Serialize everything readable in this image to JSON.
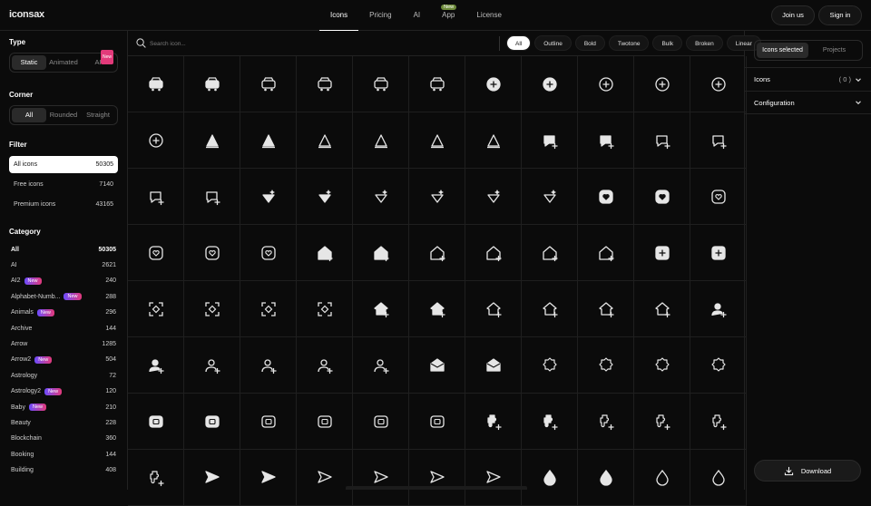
{
  "brand": {
    "logo": "iconsax"
  },
  "nav": {
    "items": [
      {
        "label": "Icons",
        "active": true
      },
      {
        "label": "Pricing"
      },
      {
        "label": "AI"
      },
      {
        "label": "App",
        "badge": "New"
      },
      {
        "label": "License"
      }
    ],
    "join_label": "Join us",
    "signin_label": "Sign in"
  },
  "sidebar": {
    "type_title": "Type",
    "type_options": [
      "Static",
      "Animated",
      "AI"
    ],
    "type_ai_badge": "New",
    "corner_title": "Corner",
    "corner_options": [
      "All",
      "Rounded",
      "Straight"
    ],
    "filter_title": "Filter",
    "filters": [
      {
        "label": "All icons",
        "count": "50305",
        "active": true
      },
      {
        "label": "Free icons",
        "count": "7140"
      },
      {
        "label": "Premium icons",
        "count": "43165"
      }
    ],
    "category_title": "Category",
    "categories": [
      {
        "label": "All",
        "count": "50305",
        "bold": true
      },
      {
        "label": "AI",
        "count": "2621"
      },
      {
        "label": "AI2",
        "count": "240",
        "badge": "New"
      },
      {
        "label": "Alphabet-Numb...",
        "count": "288",
        "badge": "New"
      },
      {
        "label": "Animals",
        "count": "296",
        "badge": "New"
      },
      {
        "label": "Archive",
        "count": "144"
      },
      {
        "label": "Arrow",
        "count": "1285"
      },
      {
        "label": "Arrow2",
        "count": "504",
        "badge": "New"
      },
      {
        "label": "Astrology",
        "count": "72"
      },
      {
        "label": "Astrology2",
        "count": "120",
        "badge": "New"
      },
      {
        "label": "Baby",
        "count": "210",
        "badge": "New"
      },
      {
        "label": "Beauty",
        "count": "228"
      },
      {
        "label": "Blockchain",
        "count": "360"
      },
      {
        "label": "Booking",
        "count": "144"
      },
      {
        "label": "Building",
        "count": "408"
      }
    ]
  },
  "toolbar": {
    "search_placeholder": "Search icon...",
    "styles": [
      "All",
      "Outline",
      "Bold",
      "Twotone",
      "Bulk",
      "Broken",
      "Linear"
    ],
    "active_style": "All"
  },
  "grid": {
    "rows": [
      [
        "car-icon",
        "car-icon",
        "car-icon",
        "car-icon",
        "car-icon",
        "car-icon",
        "add-circle-icon",
        "add-circle-icon",
        "add-circle-icon",
        "add-circle-icon",
        "add-circle-icon"
      ],
      [
        "add-circle-icon",
        "pen-tool-icon",
        "pen-tool-icon",
        "pen-tool-icon",
        "pen-tool-icon",
        "pen-tool-icon",
        "pen-tool-icon",
        "message-add-icon",
        "message-add-icon",
        "message-add-icon",
        "message-add-icon"
      ],
      [
        "message-add-icon",
        "message-add-icon",
        "magic-wand-icon",
        "magic-wand-icon",
        "magic-wand-icon",
        "magic-wand-icon",
        "magic-wand-icon",
        "magic-wand-icon",
        "heart-square-icon",
        "heart-square-icon",
        "heart-square-icon"
      ],
      [
        "heart-square-icon",
        "heart-square-icon",
        "heart-square-icon",
        "home-add-icon",
        "home-add-icon",
        "home-add-icon",
        "home-add-icon",
        "home-add-icon",
        "home-add-icon",
        "square-add-icon",
        "square-add-icon"
      ],
      [
        "scan-add-icon",
        "scan-add-icon",
        "scan-add-icon",
        "scan-add-icon",
        "house-add-icon",
        "house-add-icon",
        "house-add-icon",
        "house-add-icon",
        "house-add-icon",
        "house-add-icon",
        "user-add-icon"
      ],
      [
        "user-add-icon",
        "user-add-icon",
        "user-add-icon",
        "user-add-icon",
        "user-add-icon",
        "mail-add-icon",
        "mail-add-icon",
        "badge-add-icon",
        "badge-add-icon",
        "badge-add-icon",
        "badge-add-icon"
      ],
      [
        "video-add-icon",
        "video-add-icon",
        "video-add-icon",
        "video-add-icon",
        "video-add-icon",
        "video-add-icon",
        "puzzle-add-icon",
        "puzzle-add-icon",
        "puzzle-add-icon",
        "puzzle-add-icon",
        "puzzle-add-icon"
      ],
      [
        "puzzle-add-icon",
        "send-add-icon",
        "send-add-icon",
        "send-add-icon",
        "send-add-icon",
        "send-add-icon",
        "send-add-icon",
        "drop-add-icon",
        "drop-add-icon",
        "drop-add-icon",
        "drop-add-icon"
      ]
    ],
    "filled_rows": [
      [
        1,
        1,
        0,
        0,
        0,
        0,
        1,
        1,
        0,
        0,
        0
      ],
      [
        0,
        1,
        1,
        0,
        0,
        0,
        0,
        1,
        1,
        0,
        0
      ],
      [
        0,
        0,
        1,
        1,
        0,
        0,
        0,
        0,
        1,
        1,
        0
      ],
      [
        0,
        0,
        0,
        1,
        1,
        0,
        0,
        0,
        0,
        1,
        1
      ],
      [
        0,
        0,
        0,
        0,
        1,
        1,
        0,
        0,
        0,
        0,
        1
      ],
      [
        1,
        0,
        0,
        0,
        0,
        1,
        1,
        0,
        0,
        0,
        0
      ],
      [
        1,
        1,
        0,
        0,
        0,
        0,
        1,
        1,
        0,
        0,
        0
      ],
      [
        0,
        1,
        1,
        0,
        0,
        0,
        0,
        1,
        1,
        0,
        0
      ]
    ]
  },
  "rpanel": {
    "tabs": [
      "Icons selected",
      "Projects"
    ],
    "icons_label": "Icons",
    "icons_count": "( 0 )",
    "configuration_label": "Configuration",
    "download_label": "Download"
  }
}
